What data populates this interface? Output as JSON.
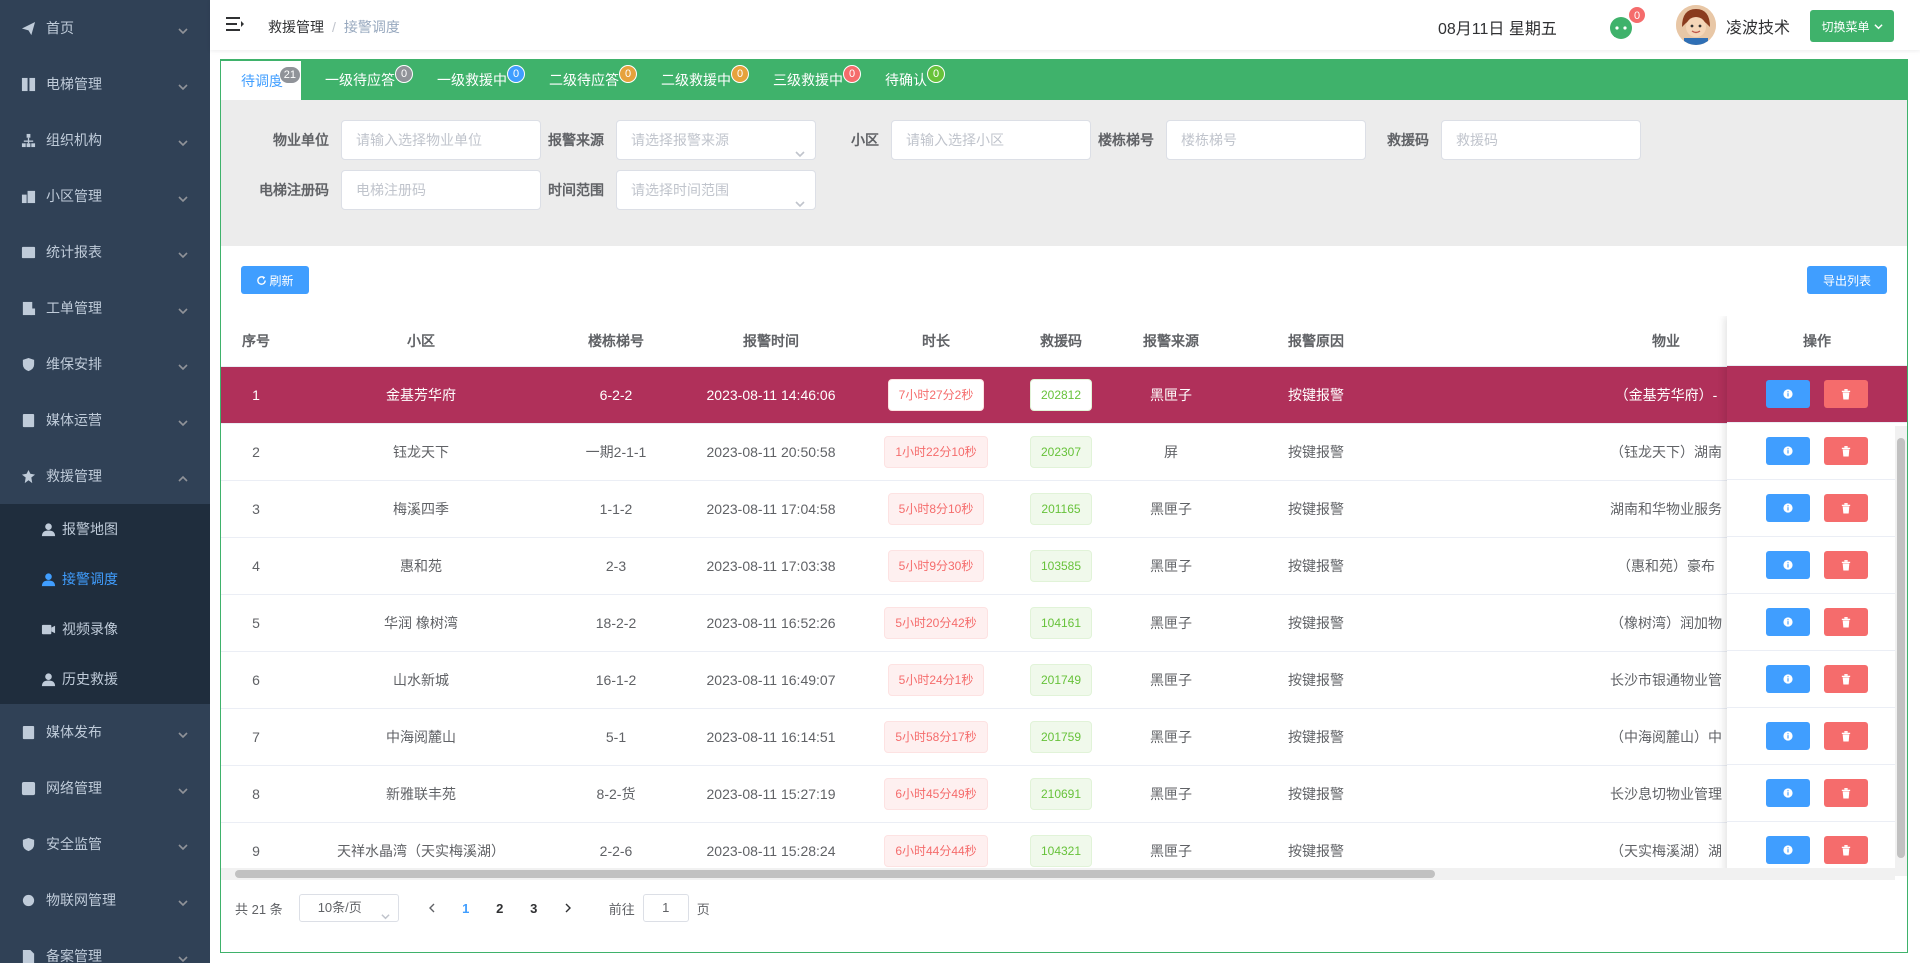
{
  "sidebar": {
    "items": [
      {
        "label": "首页",
        "icon": "send-icon"
      },
      {
        "label": "电梯管理",
        "icon": "elevator-icon"
      },
      {
        "label": "组织机构",
        "icon": "org-icon"
      },
      {
        "label": "小区管理",
        "icon": "building-icon"
      },
      {
        "label": "统计报表",
        "icon": "chart-icon"
      },
      {
        "label": "工单管理",
        "icon": "order-icon"
      },
      {
        "label": "维保安排",
        "icon": "shield-icon"
      },
      {
        "label": "媒体运营",
        "icon": "media-icon"
      },
      {
        "label": "救援管理",
        "icon": "rescue-icon",
        "expanded": true
      }
    ],
    "subitems": [
      {
        "label": "报警地图",
        "icon": "user-icon"
      },
      {
        "label": "接警调度",
        "icon": "user-icon",
        "active": true
      },
      {
        "label": "视频录像",
        "icon": "video-icon"
      },
      {
        "label": "历史救援",
        "icon": "user-icon"
      }
    ],
    "items_after": [
      {
        "label": "媒体发布",
        "icon": "media-icon"
      },
      {
        "label": "网络管理",
        "icon": "network-icon"
      },
      {
        "label": "安全监管",
        "icon": "shield-icon"
      },
      {
        "label": "物联网管理",
        "icon": "iot-icon"
      },
      {
        "label": "备案管理",
        "icon": "file-icon"
      }
    ]
  },
  "header": {
    "breadcrumb": [
      "救援管理",
      "接警调度"
    ],
    "date": "08月11日 星期五",
    "message_count": "0",
    "username": "凌波技术",
    "switch_menu": "切换菜单"
  },
  "tabs": [
    {
      "label": "待调度",
      "count": "21",
      "color": "#909399",
      "active": true
    },
    {
      "label": "一级待应答",
      "count": "0",
      "color": "#909399"
    },
    {
      "label": "一级救援中",
      "count": "0",
      "color": "#409eff"
    },
    {
      "label": "二级待应答",
      "count": "0",
      "color": "#e6a23c"
    },
    {
      "label": "二级救援中",
      "count": "0",
      "color": "#e6a23c"
    },
    {
      "label": "三级救援中",
      "count": "0",
      "color": "#f56c6c"
    },
    {
      "label": "待确认",
      "count": "0",
      "color": "#67c23a"
    }
  ],
  "filters": [
    {
      "label": "物业单位",
      "placeholder": "请输入选择物业单位",
      "select": false
    },
    {
      "label": "报警来源",
      "placeholder": "请选择报警来源",
      "select": true
    },
    {
      "label": "小区",
      "placeholder": "请输入选择小区",
      "select": false
    },
    {
      "label": "楼栋梯号",
      "placeholder": "楼栋梯号",
      "select": false
    },
    {
      "label": "救援码",
      "placeholder": "救援码",
      "select": false
    },
    {
      "label": "电梯注册码",
      "placeholder": "电梯注册码",
      "select": false
    },
    {
      "label": "时间范围",
      "placeholder": "请选择时间范围",
      "select": true
    }
  ],
  "toolbar": {
    "refresh": "刷新",
    "export": "导出列表"
  },
  "table": {
    "columns": [
      "序号",
      "小区",
      "楼栋梯号",
      "报警时间",
      "时长",
      "救援码",
      "报警来源",
      "报警原因",
      "物业"
    ],
    "action_header": "操作",
    "rows": [
      {
        "no": "1",
        "community": "金基芳华府",
        "building": "6-2-2",
        "time": "2023-08-11 14:46:06",
        "duration": "7小时27分2秒",
        "code": "202812",
        "source": "黑匣子",
        "reason": "按键报警",
        "property": "（金基芳华府）-",
        "highlight": true
      },
      {
        "no": "2",
        "community": "钰龙天下",
        "building": "一期2-1-1",
        "time": "2023-08-11 20:50:58",
        "duration": "1小时22分10秒",
        "code": "202307",
        "source": "屏",
        "reason": "按键报警",
        "property": "（钰龙天下）湖南"
      },
      {
        "no": "3",
        "community": "梅溪四季",
        "building": "1-1-2",
        "time": "2023-08-11 17:04:58",
        "duration": "5小时8分10秒",
        "code": "201165",
        "source": "黑匣子",
        "reason": "按键报警",
        "property": "湖南和华物业服务"
      },
      {
        "no": "4",
        "community": "惠和苑",
        "building": "2-3",
        "time": "2023-08-11 17:03:38",
        "duration": "5小时9分30秒",
        "code": "103585",
        "source": "黑匣子",
        "reason": "按键报警",
        "property": "（惠和苑）豪布"
      },
      {
        "no": "5",
        "community": "华润 橡树湾",
        "building": "18-2-2",
        "time": "2023-08-11 16:52:26",
        "duration": "5小时20分42秒",
        "code": "104161",
        "source": "黑匣子",
        "reason": "按键报警",
        "property": "（橡树湾）润加物"
      },
      {
        "no": "6",
        "community": "山水新城",
        "building": "16-1-2",
        "time": "2023-08-11 16:49:07",
        "duration": "5小时24分1秒",
        "code": "201749",
        "source": "黑匣子",
        "reason": "按键报警",
        "property": "长沙市银通物业管"
      },
      {
        "no": "7",
        "community": "中海阅麓山",
        "building": "5-1",
        "time": "2023-08-11 16:14:51",
        "duration": "5小时58分17秒",
        "code": "201759",
        "source": "黑匣子",
        "reason": "按键报警",
        "property": "（中海阅麓山）中"
      },
      {
        "no": "8",
        "community": "新雅联丰苑",
        "building": "8-2-货",
        "time": "2023-08-11 15:27:19",
        "duration": "6小时45分49秒",
        "code": "210691",
        "source": "黑匣子",
        "reason": "按键报警",
        "property": "长沙息切物业管理"
      },
      {
        "no": "9",
        "community": "天祥水晶湾（天实梅溪湖）",
        "building": "2-2-6",
        "time": "2023-08-11 15:28:24",
        "duration": "6小时44分44秒",
        "code": "104321",
        "source": "黑匣子",
        "reason": "按键报警",
        "property": "（天实梅溪湖）湖"
      }
    ]
  },
  "pagination": {
    "total": "共 21 条",
    "page_size": "10条/页",
    "pages": [
      "1",
      "2",
      "3"
    ],
    "current": "1",
    "goto_prefix": "前往",
    "goto_value": "1",
    "goto_suffix": "页"
  }
}
